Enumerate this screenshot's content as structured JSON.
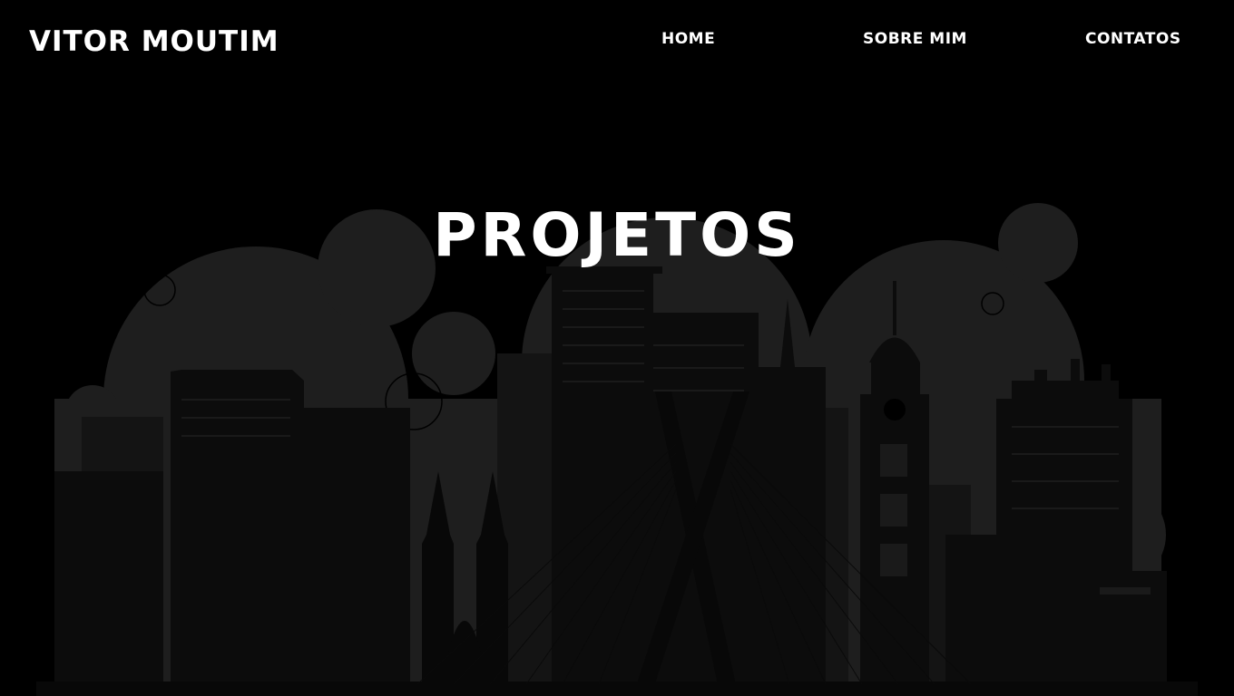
{
  "header": {
    "logo": "VITOR MOUTIM",
    "nav": [
      {
        "label": "HOME"
      },
      {
        "label": "SOBRE MIM"
      },
      {
        "label": "CONTATOS"
      }
    ]
  },
  "hero": {
    "title": "PROJETOS"
  },
  "colors": {
    "background": "#000000",
    "text": "#ffffff",
    "backdrop": "#1e1e1e",
    "building_far": "#141414",
    "building_mid": "#0c0c0c",
    "building_near": "#080808",
    "windows": "#1a1a1a"
  }
}
